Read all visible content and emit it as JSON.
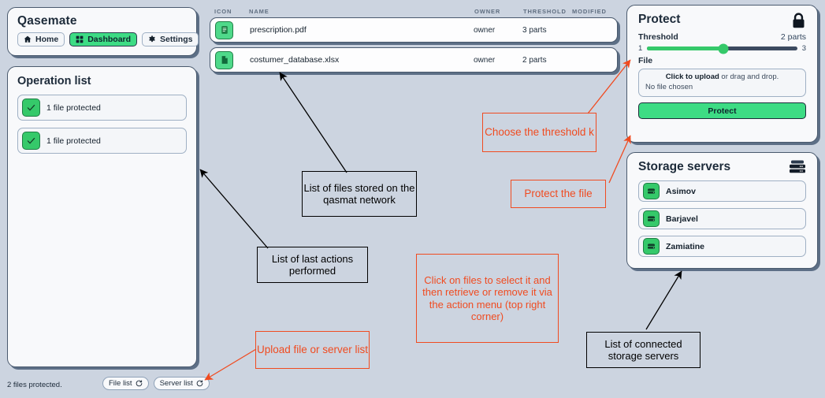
{
  "app": {
    "title": "Qasemate",
    "nav": [
      {
        "label": "Home",
        "icon": "home-icon",
        "active": false
      },
      {
        "label": "Dashboard",
        "icon": "grid-icon",
        "active": true
      },
      {
        "label": "Settings",
        "icon": "gear-icon",
        "active": false
      }
    ]
  },
  "operation_list": {
    "title": "Operation list",
    "items": [
      {
        "label": "1 file protected",
        "icon": "check-icon"
      },
      {
        "label": "1 file protected",
        "icon": "check-icon"
      }
    ]
  },
  "status_bar": {
    "text": "2 files protected.",
    "buttons": [
      {
        "label": "File list",
        "icon": "refresh-icon"
      },
      {
        "label": "Server list",
        "icon": "refresh-icon"
      }
    ]
  },
  "file_table": {
    "columns": [
      "ICON",
      "NAME",
      "OWNER",
      "THRESHOLD",
      "MODIFIED"
    ],
    "rows": [
      {
        "icon": "pdf-file-icon",
        "name": "prescription.pdf",
        "owner": "owner",
        "threshold": "3 parts",
        "modified": ""
      },
      {
        "icon": "xlsx-file-icon",
        "name": "costumer_database.xlsx",
        "owner": "owner",
        "threshold": "2 parts",
        "modified": ""
      }
    ]
  },
  "protect": {
    "title": "Protect",
    "icon": "lock-icon",
    "threshold_label": "Threshold",
    "threshold_value": "2 parts",
    "slider_min": "1",
    "slider_max": "3",
    "slider_position_pct": 51,
    "file_label": "File",
    "upload_bold": "Click to upload",
    "upload_rest": " or drag and drop.",
    "upload_status": "No file chosen",
    "button_label": "Protect"
  },
  "storage": {
    "title": "Storage servers",
    "icon": "server-stack-icon",
    "servers": [
      {
        "name": "Asimov",
        "icon": "server-icon"
      },
      {
        "name": "Barjavel",
        "icon": "server-icon"
      },
      {
        "name": "Zamiatine",
        "icon": "server-icon"
      }
    ]
  },
  "annotations": [
    {
      "id": "files-note",
      "text": "List of files stored on the qasmat network",
      "color": "#000000"
    },
    {
      "id": "actions-note",
      "text": "List of last actions performed",
      "color": "#000000"
    },
    {
      "id": "servers-note",
      "text": "List of connected storage servers",
      "color": "#000000"
    },
    {
      "id": "threshold-note",
      "text": "Choose the threshold k",
      "color": "#f04b20"
    },
    {
      "id": "protect-note",
      "text": "Protect the file",
      "color": "#f04b20"
    },
    {
      "id": "select-note",
      "text": "Click on files to select it and then retrieve or remove it via the action menu (top right corner)",
      "color": "#f04b20"
    },
    {
      "id": "upload-note",
      "text": "Upload file or server list",
      "color": "#f04b20"
    }
  ],
  "colors": {
    "background": "#ccd4e0",
    "accent_green": "#3ddc84",
    "panel_border": "#4a5a6e",
    "annotation_orange": "#f04b20",
    "text_dark": "#1d2b3a"
  }
}
